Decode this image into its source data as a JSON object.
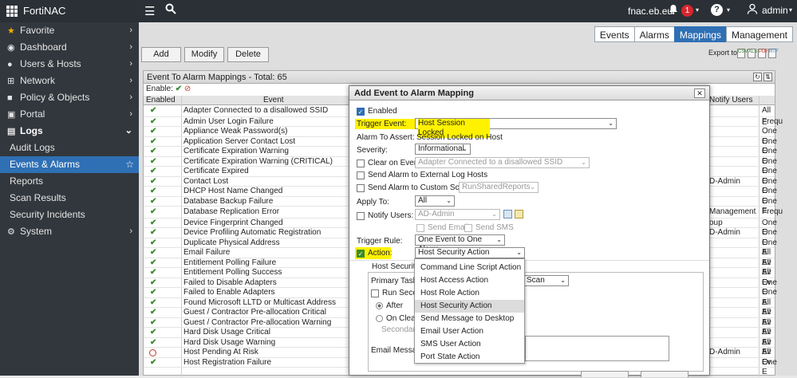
{
  "topbar": {
    "brand": "FortiNAC",
    "host": "fnac.eb.eu",
    "badge": "1",
    "user": "admin"
  },
  "sidebar": [
    {
      "label": "Favorite",
      "icon": "star-icon",
      "chev": "›"
    },
    {
      "label": "Dashboard",
      "icon": "dashboard-icon",
      "chev": "›"
    },
    {
      "label": "Users & Hosts",
      "icon": "user-icon",
      "chev": "›"
    },
    {
      "label": "Network",
      "icon": "network-icon",
      "chev": "›"
    },
    {
      "label": "Policy & Objects",
      "icon": "lock-icon",
      "chev": "›"
    },
    {
      "label": "Portal",
      "icon": "portal-icon",
      "chev": "›"
    },
    {
      "label": "Logs",
      "icon": "logs-icon",
      "chev": "⌄"
    },
    {
      "label": "Audit Logs"
    },
    {
      "label": "Events & Alarms"
    },
    {
      "label": "Reports"
    },
    {
      "label": "Scan Results"
    },
    {
      "label": "Security Incidents"
    },
    {
      "label": "System",
      "icon": "gear-icon",
      "chev": "›"
    }
  ],
  "tabs": [
    "Events",
    "Alarms",
    "Mappings",
    "Management"
  ],
  "toolbar": {
    "add": "Add",
    "modify": "Modify",
    "delete": "Delete",
    "export": "Export to:"
  },
  "panel": {
    "title": "Event To Alarm Mappings - Total: 65",
    "enable": "Enable:",
    "col_enabled": "Enabled",
    "col_event": "Event",
    "col_notify": "Notify Users"
  },
  "rows": [
    {
      "name": "Adapter Connected to a disallowed SSID",
      "right": "All E",
      "tall": true
    },
    {
      "name": "Admin User Login Failure",
      "right": "Frequ"
    },
    {
      "name": "Appliance Weak Password(s)",
      "right": "One E"
    },
    {
      "name": "Application Server Contact Lost",
      "right": "One E"
    },
    {
      "name": "Certificate Expiration Warning",
      "right": "One E"
    },
    {
      "name": "Certificate Expiration Warning (CRITICAL)",
      "right": "One E"
    },
    {
      "name": "Certificate Expired",
      "right": "One E"
    },
    {
      "name": "Contact Lost",
      "right": "One E",
      "notify": "D-Admin"
    },
    {
      "name": "DHCP Host Name Changed",
      "right": "One E"
    },
    {
      "name": "Database Backup Failure",
      "right": "One E"
    },
    {
      "name": "Database Replication Error",
      "right": "Frequ",
      "tall": true,
      "notify": "Management"
    },
    {
      "name": "Device Fingerprint Changed",
      "right": "One E",
      "notify": "oup"
    },
    {
      "name": "Device Profiling Automatic Registration",
      "right": "One E",
      "notify": "D-Admin"
    },
    {
      "name": "Duplicate Physical Address",
      "right": "One E"
    },
    {
      "name": "Email Failure",
      "right": "All Ev"
    },
    {
      "name": "Entitlement Polling Failure",
      "right": "All Ev"
    },
    {
      "name": "Entitlement Polling Success",
      "right": "All Ev"
    },
    {
      "name": "Failed to Disable Adapters",
      "right": "One E"
    },
    {
      "name": "Failed to Enable Adapters",
      "right": "One E"
    },
    {
      "name": "Found Microsoft LLTD or Multicast Address",
      "right": "All Ev"
    },
    {
      "name": "Guest / Contractor Pre-allocation Critical",
      "right": "All Ev"
    },
    {
      "name": "Guest / Contractor Pre-allocation Warning",
      "right": "All Ev"
    },
    {
      "name": "Hard Disk Usage Critical",
      "right": "All Ev"
    },
    {
      "name": "Hard Disk Usage Warning",
      "right": "All Ev"
    },
    {
      "name": "Host Pending At Risk",
      "right": "All Ev",
      "disabled": true,
      "notify": "D-Admin"
    },
    {
      "name": "Host Registration Failure",
      "right": "One E"
    }
  ],
  "modal": {
    "title": "Add Event to Alarm Mapping",
    "enabled": "Enabled",
    "trigger_event_label": "Trigger Event:",
    "trigger_event_value": "Host Session Locked",
    "alarm_assert_label": "Alarm To Assert:",
    "alarm_assert_value": "Session Locked on Host",
    "severity_label": "Severity:",
    "severity_value": "Informational",
    "clear_on_event": "Clear on Event:",
    "clear_event_value": "Adapter Connected to a disallowed SSID",
    "send_external": "Send Alarm to External Log Hosts",
    "send_custom": "Send Alarm to Custom Script:",
    "custom_script_value": "RunSharedReports",
    "apply_to_label": "Apply To:",
    "apply_to_value": "All",
    "notify_users": "Notify Users:",
    "notify_value": "AD-Admin",
    "send_email": "Send Email",
    "send_sms": "Send SMS",
    "trigger_rule_label": "Trigger Rule:",
    "trigger_rule_value": "One Event to One Alarm",
    "action_label": "Action:",
    "action_value": "Host Security Action",
    "sub_title": "Host Security",
    "primary_task": "Primary Task:",
    "primary_value": "Scan",
    "run_second": "Run Secon",
    "after": "After",
    "on_clear": "On Clear",
    "secondary": "Secondary",
    "email_msg": "Email Messag"
  },
  "dropdown": [
    "Command Line Script Action",
    "Host Access Action",
    "Host Role Action",
    "Host Security Action",
    "Send Message to Desktop",
    "Email User Action",
    "SMS User Action",
    "Port State Action"
  ],
  "dropdown_selected": 3,
  "colors": {
    "accent": "#2f6fb4",
    "highlight": "#fff200",
    "sidebar": "#32373d",
    "topbar": "#2b3036"
  }
}
